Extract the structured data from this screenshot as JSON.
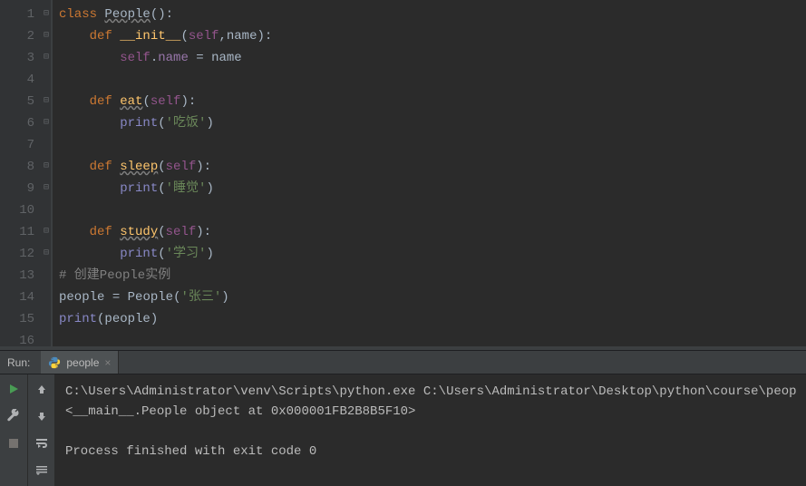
{
  "gutter": {
    "lines": [
      "1",
      "2",
      "3",
      "4",
      "5",
      "6",
      "7",
      "8",
      "9",
      "10",
      "11",
      "12",
      "13",
      "14",
      "15",
      "16"
    ]
  },
  "code": {
    "t1": {
      "kw": "class ",
      "cls": "People",
      "paren": "():"
    },
    "t2": {
      "kw": "def ",
      "name": "__init__",
      "open": "(",
      "self": "self",
      "comma": ",",
      "p": "name",
      "close": "):"
    },
    "t3": {
      "self": "self",
      "dot": ".",
      "attr": "name",
      "eq": " = ",
      "rhs": "name"
    },
    "t5": {
      "kw": "def ",
      "name": "eat",
      "open": "(",
      "self": "self",
      "close": "):"
    },
    "t6": {
      "fn": "print",
      "open": "(",
      "s": "'吃饭'",
      "close": ")"
    },
    "t8": {
      "kw": "def ",
      "name": "sleep",
      "open": "(",
      "self": "self",
      "close": "):"
    },
    "t9": {
      "fn": "print",
      "open": "(",
      "s": "'睡觉'",
      "close": ")"
    },
    "t11": {
      "kw": "def ",
      "name": "study",
      "open": "(",
      "self": "self",
      "close": "):"
    },
    "t12": {
      "fn": "print",
      "open": "(",
      "s": "'学习'",
      "close": ")"
    },
    "t13": {
      "c": "# 创建People实例"
    },
    "t14": {
      "lhs": "people",
      "eq": " = ",
      "cls": "People",
      "open": "(",
      "s": "'张三'",
      "close": ")"
    },
    "t15": {
      "fn": "print",
      "open": "(",
      "arg": "people",
      "close": ")"
    }
  },
  "run": {
    "label": "Run:",
    "tab_name": "people",
    "output_line1": "C:\\Users\\Administrator\\venv\\Scripts\\python.exe C:\\Users\\Administrator\\Desktop\\python\\course\\peop",
    "output_line2": "<__main__.People object at 0x000001FB2B8B5F10>",
    "output_line3": "",
    "output_line4": "Process finished with exit code 0"
  }
}
